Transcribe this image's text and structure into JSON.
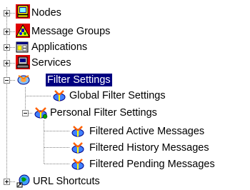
{
  "tree": {
    "items": [
      {
        "label": "Nodes",
        "icon": "nodes-icon",
        "state": "collapsed"
      },
      {
        "label": "Message Groups",
        "icon": "message-groups-icon",
        "state": "collapsed"
      },
      {
        "label": "Applications",
        "icon": "applications-icon",
        "state": "collapsed"
      },
      {
        "label": "Services",
        "icon": "services-icon",
        "state": "collapsed"
      },
      {
        "label": "Filter Settings",
        "icon": "filter-settings-icon",
        "state": "expanded",
        "selected": true
      },
      {
        "label": "Global Filter Settings",
        "icon": "global-filter-icon"
      },
      {
        "label": "Personal Filter Settings",
        "icon": "personal-filter-icon",
        "state": "expanded"
      },
      {
        "label": "Filtered Active Messages",
        "icon": "filter-icon"
      },
      {
        "label": "Filtered History Messages",
        "icon": "filter-icon"
      },
      {
        "label": "Filtered Pending Messages",
        "icon": "filter-icon"
      },
      {
        "label": "URL Shortcuts",
        "icon": "url-shortcuts-icon",
        "state": "collapsed"
      }
    ]
  },
  "colors": {
    "selection_bg": "#000080",
    "selection_text": "#ffffff",
    "tree_lines": "#808080"
  }
}
